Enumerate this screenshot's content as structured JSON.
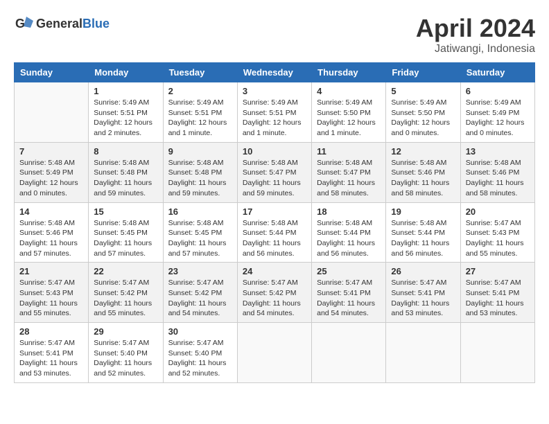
{
  "header": {
    "logo_general": "General",
    "logo_blue": "Blue",
    "month_title": "April 2024",
    "location": "Jatiwangi, Indonesia"
  },
  "days_of_week": [
    "Sunday",
    "Monday",
    "Tuesday",
    "Wednesday",
    "Thursday",
    "Friday",
    "Saturday"
  ],
  "weeks": [
    [
      {
        "day": "",
        "info": ""
      },
      {
        "day": "1",
        "info": "Sunrise: 5:49 AM\nSunset: 5:51 PM\nDaylight: 12 hours\nand 2 minutes."
      },
      {
        "day": "2",
        "info": "Sunrise: 5:49 AM\nSunset: 5:51 PM\nDaylight: 12 hours\nand 1 minute."
      },
      {
        "day": "3",
        "info": "Sunrise: 5:49 AM\nSunset: 5:51 PM\nDaylight: 12 hours\nand 1 minute."
      },
      {
        "day": "4",
        "info": "Sunrise: 5:49 AM\nSunset: 5:50 PM\nDaylight: 12 hours\nand 1 minute."
      },
      {
        "day": "5",
        "info": "Sunrise: 5:49 AM\nSunset: 5:50 PM\nDaylight: 12 hours\nand 0 minutes."
      },
      {
        "day": "6",
        "info": "Sunrise: 5:49 AM\nSunset: 5:49 PM\nDaylight: 12 hours\nand 0 minutes."
      }
    ],
    [
      {
        "day": "7",
        "info": "Sunrise: 5:48 AM\nSunset: 5:49 PM\nDaylight: 12 hours\nand 0 minutes."
      },
      {
        "day": "8",
        "info": "Sunrise: 5:48 AM\nSunset: 5:48 PM\nDaylight: 11 hours\nand 59 minutes."
      },
      {
        "day": "9",
        "info": "Sunrise: 5:48 AM\nSunset: 5:48 PM\nDaylight: 11 hours\nand 59 minutes."
      },
      {
        "day": "10",
        "info": "Sunrise: 5:48 AM\nSunset: 5:47 PM\nDaylight: 11 hours\nand 59 minutes."
      },
      {
        "day": "11",
        "info": "Sunrise: 5:48 AM\nSunset: 5:47 PM\nDaylight: 11 hours\nand 58 minutes."
      },
      {
        "day": "12",
        "info": "Sunrise: 5:48 AM\nSunset: 5:46 PM\nDaylight: 11 hours\nand 58 minutes."
      },
      {
        "day": "13",
        "info": "Sunrise: 5:48 AM\nSunset: 5:46 PM\nDaylight: 11 hours\nand 58 minutes."
      }
    ],
    [
      {
        "day": "14",
        "info": "Sunrise: 5:48 AM\nSunset: 5:46 PM\nDaylight: 11 hours\nand 57 minutes."
      },
      {
        "day": "15",
        "info": "Sunrise: 5:48 AM\nSunset: 5:45 PM\nDaylight: 11 hours\nand 57 minutes."
      },
      {
        "day": "16",
        "info": "Sunrise: 5:48 AM\nSunset: 5:45 PM\nDaylight: 11 hours\nand 57 minutes."
      },
      {
        "day": "17",
        "info": "Sunrise: 5:48 AM\nSunset: 5:44 PM\nDaylight: 11 hours\nand 56 minutes."
      },
      {
        "day": "18",
        "info": "Sunrise: 5:48 AM\nSunset: 5:44 PM\nDaylight: 11 hours\nand 56 minutes."
      },
      {
        "day": "19",
        "info": "Sunrise: 5:48 AM\nSunset: 5:44 PM\nDaylight: 11 hours\nand 56 minutes."
      },
      {
        "day": "20",
        "info": "Sunrise: 5:47 AM\nSunset: 5:43 PM\nDaylight: 11 hours\nand 55 minutes."
      }
    ],
    [
      {
        "day": "21",
        "info": "Sunrise: 5:47 AM\nSunset: 5:43 PM\nDaylight: 11 hours\nand 55 minutes."
      },
      {
        "day": "22",
        "info": "Sunrise: 5:47 AM\nSunset: 5:42 PM\nDaylight: 11 hours\nand 55 minutes."
      },
      {
        "day": "23",
        "info": "Sunrise: 5:47 AM\nSunset: 5:42 PM\nDaylight: 11 hours\nand 54 minutes."
      },
      {
        "day": "24",
        "info": "Sunrise: 5:47 AM\nSunset: 5:42 PM\nDaylight: 11 hours\nand 54 minutes."
      },
      {
        "day": "25",
        "info": "Sunrise: 5:47 AM\nSunset: 5:41 PM\nDaylight: 11 hours\nand 54 minutes."
      },
      {
        "day": "26",
        "info": "Sunrise: 5:47 AM\nSunset: 5:41 PM\nDaylight: 11 hours\nand 53 minutes."
      },
      {
        "day": "27",
        "info": "Sunrise: 5:47 AM\nSunset: 5:41 PM\nDaylight: 11 hours\nand 53 minutes."
      }
    ],
    [
      {
        "day": "28",
        "info": "Sunrise: 5:47 AM\nSunset: 5:41 PM\nDaylight: 11 hours\nand 53 minutes."
      },
      {
        "day": "29",
        "info": "Sunrise: 5:47 AM\nSunset: 5:40 PM\nDaylight: 11 hours\nand 52 minutes."
      },
      {
        "day": "30",
        "info": "Sunrise: 5:47 AM\nSunset: 5:40 PM\nDaylight: 11 hours\nand 52 minutes."
      },
      {
        "day": "",
        "info": ""
      },
      {
        "day": "",
        "info": ""
      },
      {
        "day": "",
        "info": ""
      },
      {
        "day": "",
        "info": ""
      }
    ]
  ]
}
